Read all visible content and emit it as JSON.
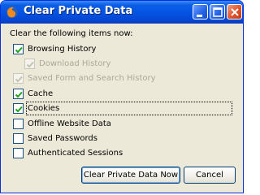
{
  "window": {
    "title": "Clear Private Data",
    "title_color": "#ffffff",
    "accent": "#0554e3"
  },
  "dialog": {
    "instruction": "Clear the following items now:",
    "items": [
      {
        "label": "Browsing History",
        "checked": true,
        "enabled": true
      },
      {
        "label": "Download History",
        "checked": true,
        "enabled": false
      },
      {
        "label": "Saved Form and Search History",
        "checked": true,
        "enabled": false
      },
      {
        "label": "Cache",
        "checked": true,
        "enabled": true
      },
      {
        "label": "Cookies",
        "checked": true,
        "enabled": true,
        "focused": true
      },
      {
        "label": "Offline Website Data",
        "checked": false,
        "enabled": true
      },
      {
        "label": "Saved Passwords",
        "checked": false,
        "enabled": true
      },
      {
        "label": "Authenticated Sessions",
        "checked": false,
        "enabled": true
      }
    ],
    "buttons": {
      "primary": "Clear Private Data Now",
      "cancel": "Cancel"
    }
  },
  "icons": {
    "app": "firefox-icon",
    "minimize": "minimize-icon",
    "maximize": "maximize-icon",
    "close": "close-icon"
  }
}
